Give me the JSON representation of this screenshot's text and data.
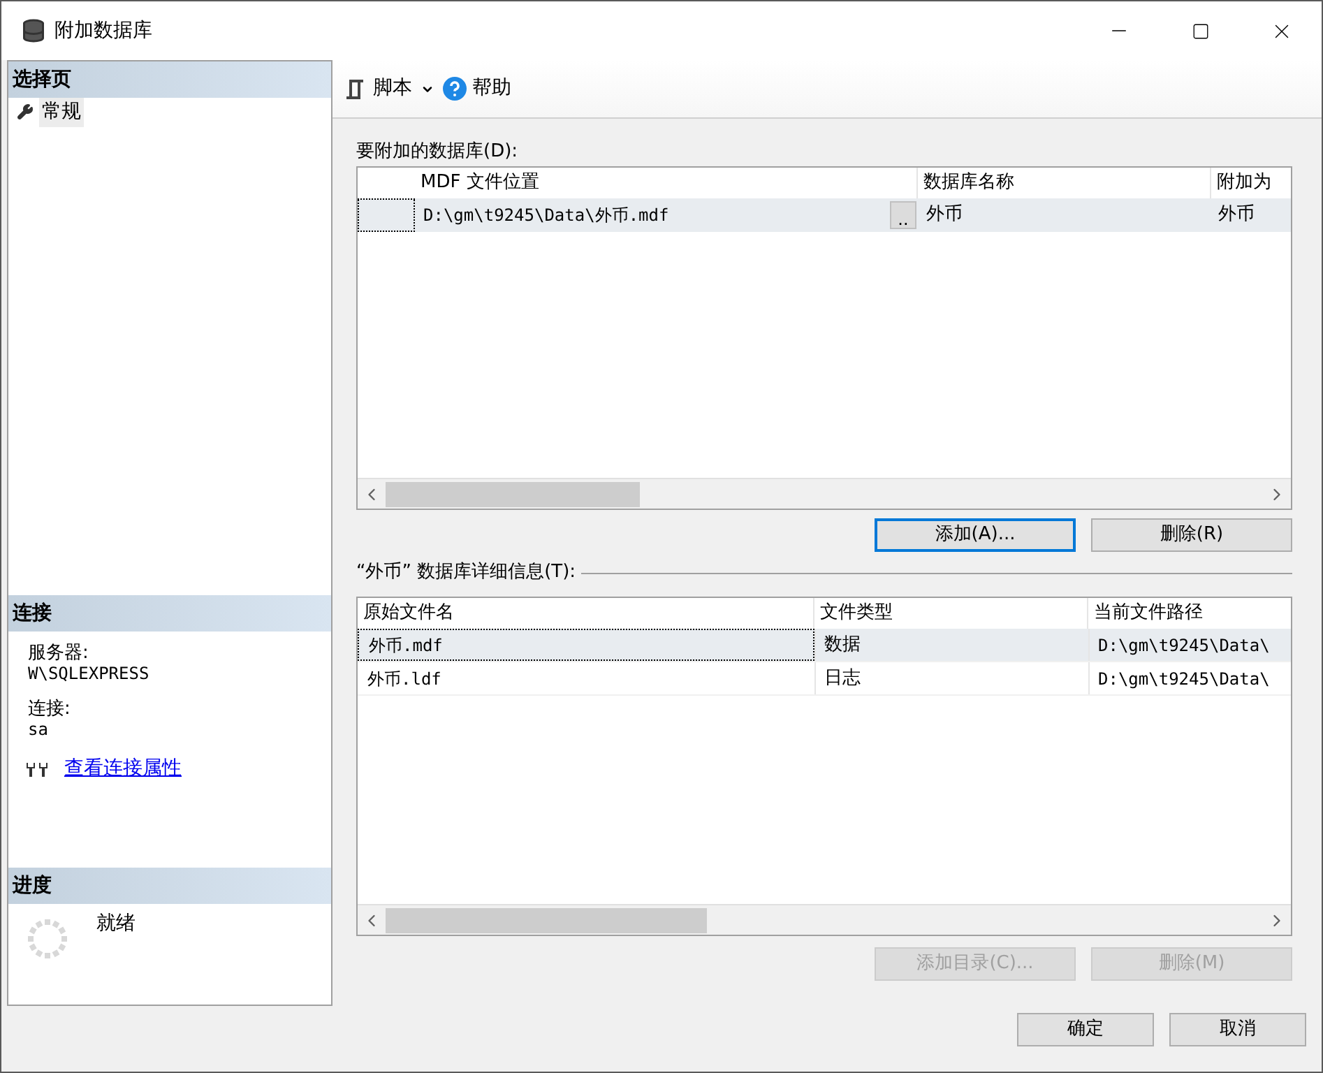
{
  "window": {
    "title": "附加数据库"
  },
  "sidebar": {
    "pages_header": "选择页",
    "pages": [
      {
        "label": "常规",
        "selected": true
      }
    ],
    "connection_header": "连接",
    "server_label": "服务器:",
    "server": "W\\SQLEXPRESS",
    "login_label": "连接:",
    "login": "sa",
    "link": "查看连接属性",
    "progress_header": "进度",
    "progress_status": "就绪"
  },
  "toolbar": {
    "script": "脚本",
    "help": "帮助"
  },
  "databases": {
    "label": "要附加的数据库(D):",
    "columns": [
      "MDF 文件位置",
      "数据库名称",
      "附加为"
    ],
    "rows": [
      {
        "location": "D:\\gm\\t9245\\Data\\外币.mdf",
        "browse": "..",
        "name": "外币",
        "attach_as": "外币",
        "selected": true
      }
    ],
    "buttons": [
      {
        "label": "添加(A)...",
        "disabled": false,
        "focused": true
      },
      {
        "label": "删除(R)",
        "disabled": false,
        "focused": false
      }
    ]
  },
  "details": {
    "label": "“外币” 数据库详细信息(T):",
    "columns": [
      "原始文件名",
      "文件类型",
      "当前文件路径"
    ],
    "rows": [
      {
        "file": "外币.mdf",
        "type": "数据",
        "path": "D:\\gm\\t9245\\Data\\",
        "selected": true
      },
      {
        "file": "外币.ldf",
        "type": "日志",
        "path": "D:\\gm\\t9245\\Data\\",
        "selected": false
      }
    ],
    "buttons": [
      {
        "label": "添加目录(C)...",
        "disabled": true,
        "focused": false
      },
      {
        "label": "删除(M)",
        "disabled": true,
        "focused": false
      }
    ]
  },
  "footer": {
    "buttons": [
      {
        "label": "确定",
        "disabled": false,
        "focused": false
      },
      {
        "label": "取消",
        "disabled": false,
        "focused": false
      }
    ]
  }
}
